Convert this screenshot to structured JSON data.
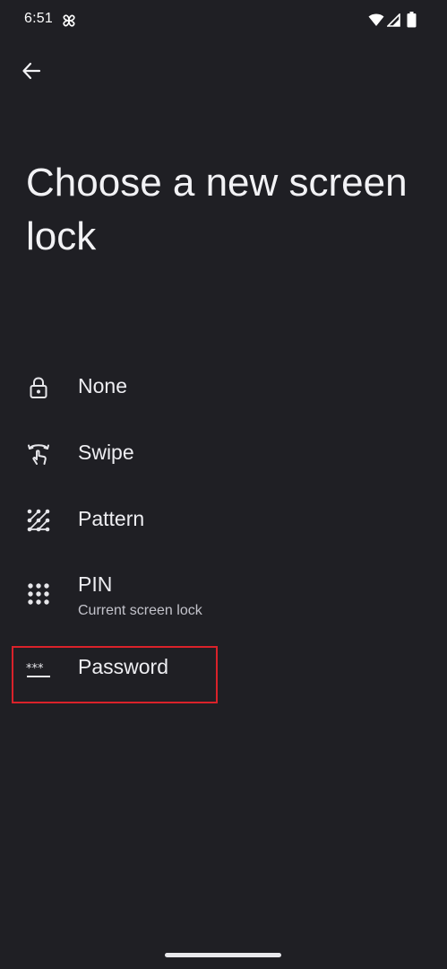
{
  "status_bar": {
    "time": "6:51",
    "icons": [
      "pinwheel-icon",
      "wifi-icon",
      "signal-icon",
      "battery-icon"
    ]
  },
  "header": {
    "back_icon": "arrow-back-icon"
  },
  "page": {
    "title": "Choose a new screen lock"
  },
  "options": [
    {
      "id": "none",
      "label": "None",
      "summary": "",
      "icon": "lock-icon"
    },
    {
      "id": "swipe",
      "label": "Swipe",
      "summary": "",
      "icon": "swipe-icon"
    },
    {
      "id": "pattern",
      "label": "Pattern",
      "summary": "",
      "icon": "pattern-icon"
    },
    {
      "id": "pin",
      "label": "PIN",
      "summary": "Current screen lock",
      "icon": "dialpad-icon"
    },
    {
      "id": "password",
      "label": "Password",
      "summary": "",
      "icon": "password-icon"
    }
  ],
  "colors": {
    "background": "#1f1f24",
    "text": "#eeeef2",
    "highlight": "#d9222a"
  }
}
